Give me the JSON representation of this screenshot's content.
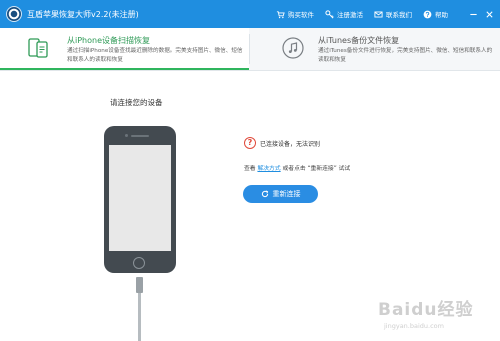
{
  "app": {
    "title": "互盾苹果恢复大师v2.2(未注册)",
    "accent_color": "#1f8ee0"
  },
  "menu": [
    {
      "label": "购买软件",
      "icon": "cart-icon"
    },
    {
      "label": "注册激活",
      "icon": "key-icon"
    },
    {
      "label": "联系我们",
      "icon": "mail-icon"
    },
    {
      "label": "帮助",
      "icon": "question-icon"
    }
  ],
  "window_controls": [
    "minimize-icon",
    "close-icon"
  ],
  "tabs": [
    {
      "title": "从iPhone设备扫描恢复",
      "desc": "通过扫描iPhone设备查找最近删除的数据。完美支持图片、微信、短信和联系人的读取和恢复",
      "icon": "phone-scan-icon",
      "active": true,
      "color": "#2e9a56"
    },
    {
      "title": "从iTunes备份文件恢复",
      "desc": "通过iTunes备份文件进行恢复，完美支持图片、微信、短信和联系人的读取和恢复",
      "icon": "music-note-icon",
      "active": false
    }
  ],
  "main": {
    "heading": "请连接您的设备",
    "status": "已连接设备，无法识别",
    "hint_prefix": "查看",
    "hint_link": "解决方式",
    "hint_suffix": "或者点击 “重新连接” 试试",
    "reconnect_label": "重新连接"
  },
  "watermark": {
    "text": "Baidu经验",
    "sub": "jingyan.baidu.com"
  }
}
